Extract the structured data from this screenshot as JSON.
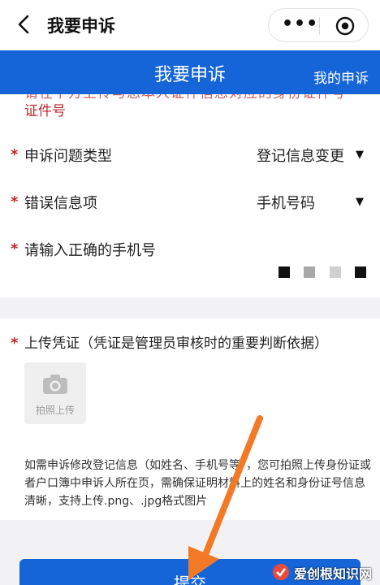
{
  "header": {
    "title": "我要申诉"
  },
  "bluebar": {
    "title": "我要申诉",
    "right_link": "我的申诉"
  },
  "notice": {
    "cut_line": "请在下方上传与您本人证件信息对应的身份证件号",
    "visible_line": "证件号"
  },
  "form": {
    "issue_type_label": "申诉问题类型",
    "issue_type_value": "登记信息变更",
    "error_item_label": "错误信息项",
    "error_item_value": "手机号码",
    "phone_label": "请输入正确的手机号"
  },
  "upload": {
    "label": "上传凭证（凭证是管理员审核时的重要判断依据）",
    "button_text": "拍照上传",
    "help_text": "如需申诉修改登记信息（如姓名、手机号等），您可拍照上传身份证或者户口簿中申诉人所在页，需确保证明材料上的姓名和身份证号信息清晰，支持上传.png、.jpg格式图片"
  },
  "submit": {
    "label": "提交"
  },
  "watermark": {
    "text": "爱创根知识网"
  },
  "colors": {
    "primary": "#1565d8",
    "required_star": "#c0282b",
    "pointer": "#f27a27"
  },
  "icons": {
    "back": "back-chevron-icon",
    "more": "more-dots-icon",
    "close": "target-close-icon",
    "camera": "camera-icon"
  }
}
